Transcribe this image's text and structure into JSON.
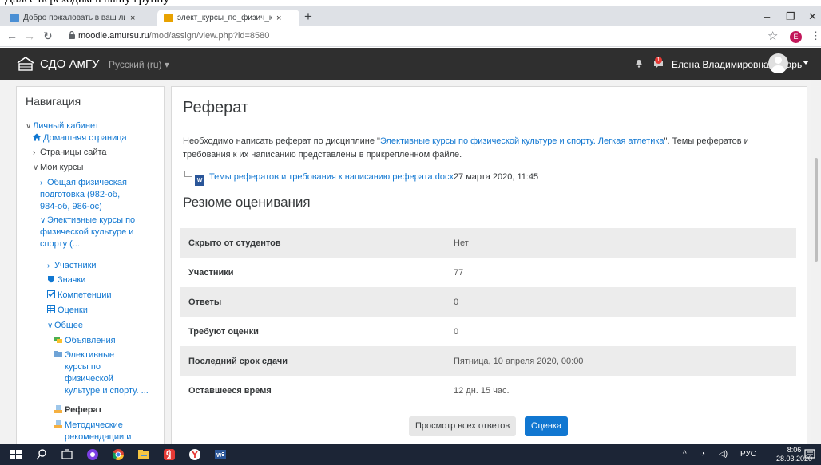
{
  "doc_caption": "Далее переходим в нашу группу",
  "browser": {
    "tabs": [
      {
        "title": "Добро пожаловать в ваш личный",
        "close": "×"
      },
      {
        "title": "элект_курсы_по_физич_культ_и",
        "close": "×"
      }
    ],
    "new_tab": "+",
    "window_controls": {
      "minimize": "–",
      "restore": "❐",
      "close": "✕"
    },
    "url_host": "moodle.amursu.ru",
    "url_path": "/mod/assign/view.php?id=8580",
    "profile_letter": "E"
  },
  "navbar": {
    "brand": "СДО АмГУ",
    "language": "Русский (ru) ▾",
    "notification_count": "1",
    "user_name": "Елена Владимировна Токарь"
  },
  "navigation": {
    "title": "Навигация",
    "items": [
      {
        "caret": "∨",
        "label": "Личный кабинет"
      },
      {
        "icon": "home-icon",
        "label": "Домашняя страница"
      },
      {
        "caret": "›",
        "label": "Страницы сайта"
      },
      {
        "caret": "∨",
        "label": "Мои курсы"
      },
      {
        "caret": "›",
        "label": "Общая физическая",
        "lines": [
          "Общая физическая",
          "подготовка (982-об,",
          "984-об, 986-ос)"
        ]
      },
      {
        "caret": "∨",
        "lines": [
          "Элективные курсы по",
          "физической культуре и",
          "спорту (..."
        ]
      },
      {
        "caret": "›",
        "label": "Участники"
      },
      {
        "icon": "badge-icon",
        "label": "Значки"
      },
      {
        "icon": "checkbox-icon",
        "label": "Компетенции"
      },
      {
        "icon": "grades-table-icon",
        "label": "Оценки"
      },
      {
        "caret": "∨",
        "label": "Общее"
      },
      {
        "icon": "forum-icon",
        "label": "Объявления"
      },
      {
        "icon": "folder-icon",
        "lines": [
          "Элективные",
          "курсы по",
          "физической",
          "культуре и спорту. ..."
        ]
      },
      {
        "icon": "assignment-icon",
        "label": "Реферат"
      },
      {
        "icon": "assignment-icon",
        "lines": [
          "Методические",
          "рекомендации и"
        ]
      }
    ]
  },
  "main": {
    "title": "Реферат",
    "description_prefix": "Необходимо написать реферат по дисциплине \"",
    "description_link": "Элективные курсы по физической культуре и спорту. Легкая атлетика",
    "description_suffix": "\". Темы рефератов и требования к их написанию представлены в прикрепленном файле.",
    "file_icon_text": "W",
    "file_name": "Темы рефератов и требования к написанию реферата.docx",
    "file_date": "27 марта 2020, 11:45",
    "summary_title": "Резюме оценивания",
    "rows": [
      {
        "label": "Скрыто от студентов",
        "value": "Нет"
      },
      {
        "label": "Участники",
        "value": "77"
      },
      {
        "label": "Ответы",
        "value": "0"
      },
      {
        "label": "Требуют оценки",
        "value": "0"
      },
      {
        "label": "Последний срок сдачи",
        "value": "Пятница, 10 апреля 2020, 00:00"
      },
      {
        "label": "Оставшееся время",
        "value": "12 дн. 15 час."
      }
    ],
    "btn_view_all": "Просмотр всех ответов",
    "btn_grade": "Оценка"
  },
  "taskbar": {
    "tray_arrow": "^",
    "tray_lang": "РУС",
    "time": "8:06",
    "date": "28.03.2020"
  },
  "colors": {
    "link": "#1177d1",
    "navbar": "#2f2f2f",
    "taskbar": "#1c2536"
  }
}
